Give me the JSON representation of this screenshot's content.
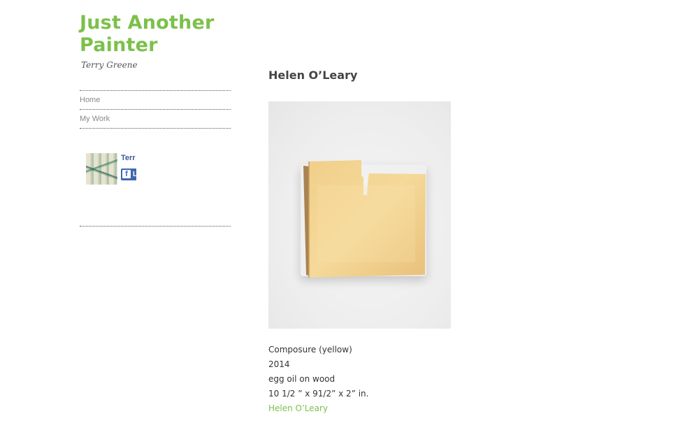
{
  "site": {
    "title": "Just Another Painter",
    "description": "Terry Greene"
  },
  "nav": {
    "items": [
      {
        "label": "Home"
      },
      {
        "label": "My Work"
      }
    ]
  },
  "facebook_widget": {
    "name": "Terr",
    "like_glyph": "f",
    "like_label": "L"
  },
  "post": {
    "title": "Helen O’Leary",
    "caption": {
      "artwork_title": "Composure (yellow)",
      "year": "2014",
      "medium": "egg oil on wood",
      "dimensions": "10 1/2 ” x 91/2” x 2” in.",
      "artist_link": "Helen O’Leary"
    }
  },
  "colors": {
    "accent": "#7cc04b",
    "facebook_blue": "#4267b2"
  }
}
